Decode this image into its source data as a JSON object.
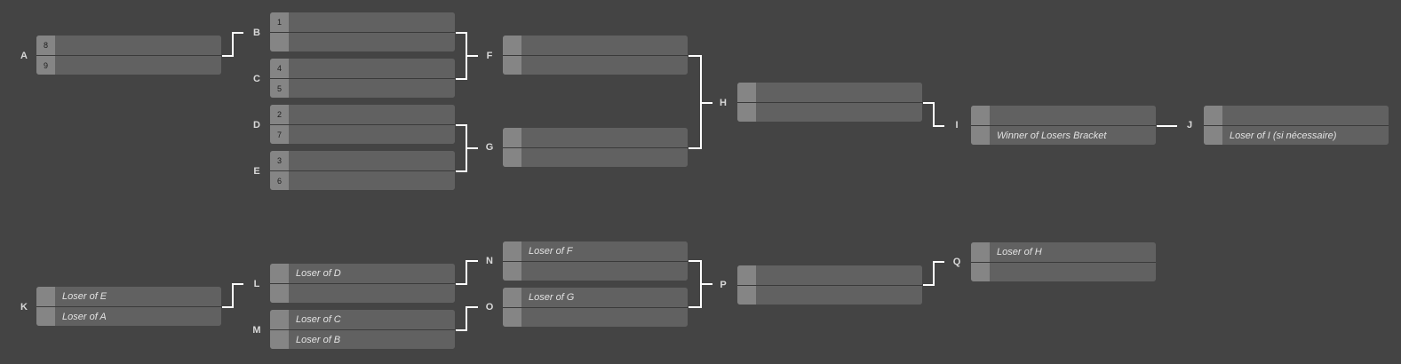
{
  "winners_bracket": {
    "A": {
      "label": "A",
      "top": {
        "seed": "8",
        "name": ""
      },
      "bottom": {
        "seed": "9",
        "name": ""
      }
    },
    "B": {
      "label": "B",
      "top": {
        "seed": "1",
        "name": ""
      },
      "bottom": {
        "seed": "",
        "name": ""
      }
    },
    "C": {
      "label": "C",
      "top": {
        "seed": "4",
        "name": ""
      },
      "bottom": {
        "seed": "5",
        "name": ""
      }
    },
    "D": {
      "label": "D",
      "top": {
        "seed": "2",
        "name": ""
      },
      "bottom": {
        "seed": "7",
        "name": ""
      }
    },
    "E": {
      "label": "E",
      "top": {
        "seed": "3",
        "name": ""
      },
      "bottom": {
        "seed": "6",
        "name": ""
      }
    },
    "F": {
      "label": "F",
      "top": {
        "seed": "",
        "name": ""
      },
      "bottom": {
        "seed": "",
        "name": ""
      }
    },
    "G": {
      "label": "G",
      "top": {
        "seed": "",
        "name": ""
      },
      "bottom": {
        "seed": "",
        "name": ""
      }
    },
    "H": {
      "label": "H",
      "top": {
        "seed": "",
        "name": ""
      },
      "bottom": {
        "seed": "",
        "name": ""
      }
    },
    "I": {
      "label": "I",
      "top": {
        "seed": "",
        "name": ""
      },
      "bottom": {
        "seed": "",
        "name": "Winner of Losers Bracket"
      }
    },
    "J": {
      "label": "J",
      "top": {
        "seed": "",
        "name": ""
      },
      "bottom": {
        "seed": "",
        "name": "Loser of I (si nécessaire)"
      }
    }
  },
  "losers_bracket": {
    "K": {
      "label": "K",
      "top": {
        "seed": "",
        "name": "Loser of E"
      },
      "bottom": {
        "seed": "",
        "name": "Loser of A"
      }
    },
    "L": {
      "label": "L",
      "top": {
        "seed": "",
        "name": "Loser of D"
      },
      "bottom": {
        "seed": "",
        "name": ""
      }
    },
    "M": {
      "label": "M",
      "top": {
        "seed": "",
        "name": "Loser of C"
      },
      "bottom": {
        "seed": "",
        "name": "Loser of B"
      }
    },
    "N": {
      "label": "N",
      "top": {
        "seed": "",
        "name": "Loser of F"
      },
      "bottom": {
        "seed": "",
        "name": ""
      }
    },
    "O": {
      "label": "O",
      "top": {
        "seed": "",
        "name": "Loser of G"
      },
      "bottom": {
        "seed": "",
        "name": ""
      }
    },
    "P": {
      "label": "P",
      "top": {
        "seed": "",
        "name": ""
      },
      "bottom": {
        "seed": "",
        "name": ""
      }
    },
    "Q": {
      "label": "Q",
      "top": {
        "seed": "",
        "name": "Loser of H"
      },
      "bottom": {
        "seed": "",
        "name": ""
      }
    }
  },
  "colors": {
    "background": "#444444",
    "match": "#616161",
    "seed_box": "#858585",
    "connector": "#ffffff"
  }
}
